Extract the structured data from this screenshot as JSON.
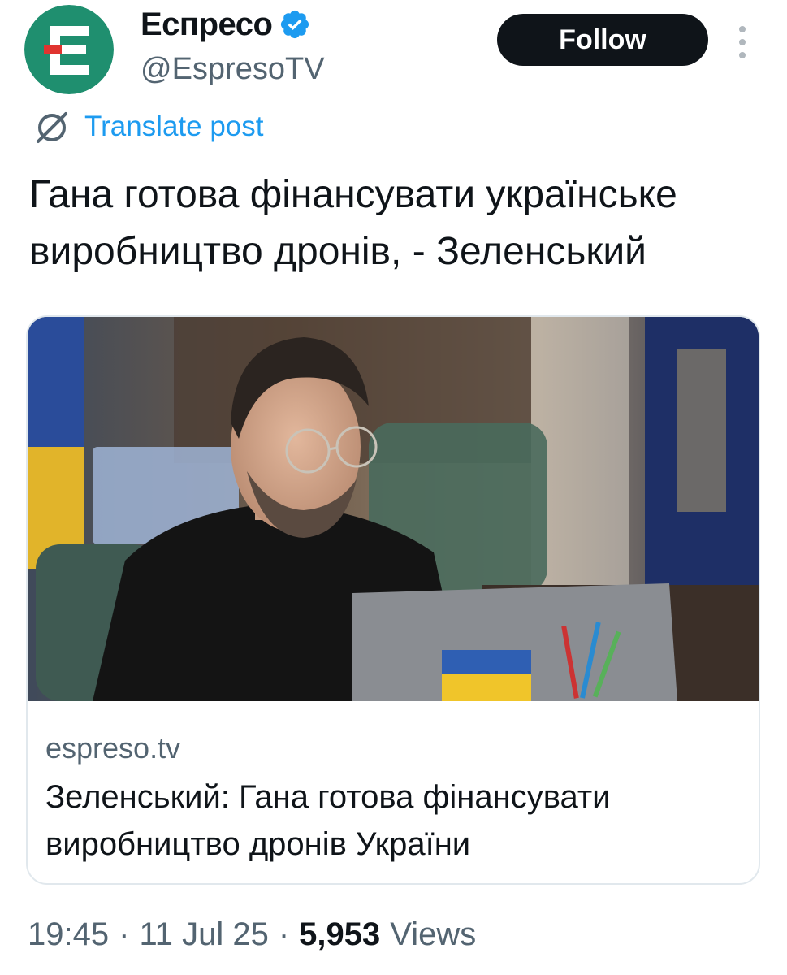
{
  "account": {
    "display_name": "Еспресо",
    "handle": "@EspresoTV",
    "verified": true,
    "avatar_icon": "espreso-logo-icon",
    "avatar_color": "#1f8f6f"
  },
  "header": {
    "follow_label": "Follow",
    "more_icon": "more-options-icon"
  },
  "translate": {
    "icon": "globe-translate-icon",
    "label": "Translate post"
  },
  "post": {
    "text": "Гана готова фінансувати українське виробництво дронів, - Зеленський"
  },
  "link_card": {
    "image_description_icon": "article-photo",
    "domain": "espreso.tv",
    "title": "Зеленський: Гана готова фінансувати виробництво дронів України"
  },
  "meta": {
    "time": "19:45",
    "date": "11 Jul 25",
    "views_count": "5,953",
    "views_label": "Views",
    "separator": "·"
  },
  "colors": {
    "accent": "#1d9bf0",
    "secondary_text": "#536471",
    "primary_text": "#0f1419",
    "button_bg": "#0f1419"
  }
}
